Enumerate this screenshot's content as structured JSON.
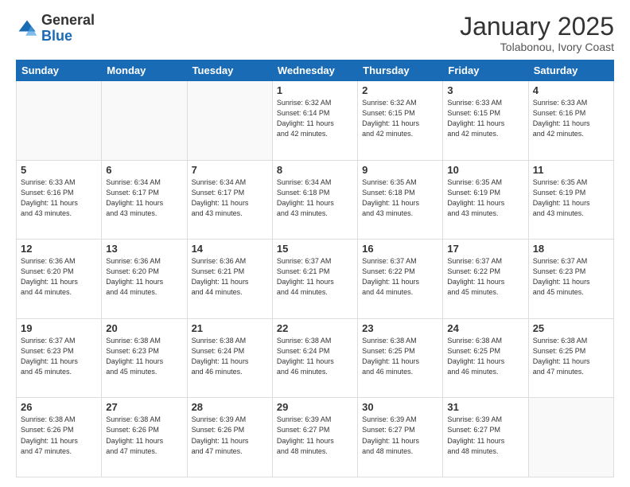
{
  "header": {
    "logo_general": "General",
    "logo_blue": "Blue",
    "month_title": "January 2025",
    "location": "Tolabonou, Ivory Coast"
  },
  "days_of_week": [
    "Sunday",
    "Monday",
    "Tuesday",
    "Wednesday",
    "Thursday",
    "Friday",
    "Saturday"
  ],
  "weeks": [
    [
      {
        "day": "",
        "info": ""
      },
      {
        "day": "",
        "info": ""
      },
      {
        "day": "",
        "info": ""
      },
      {
        "day": "1",
        "info": "Sunrise: 6:32 AM\nSunset: 6:14 PM\nDaylight: 11 hours\nand 42 minutes."
      },
      {
        "day": "2",
        "info": "Sunrise: 6:32 AM\nSunset: 6:15 PM\nDaylight: 11 hours\nand 42 minutes."
      },
      {
        "day": "3",
        "info": "Sunrise: 6:33 AM\nSunset: 6:15 PM\nDaylight: 11 hours\nand 42 minutes."
      },
      {
        "day": "4",
        "info": "Sunrise: 6:33 AM\nSunset: 6:16 PM\nDaylight: 11 hours\nand 42 minutes."
      }
    ],
    [
      {
        "day": "5",
        "info": "Sunrise: 6:33 AM\nSunset: 6:16 PM\nDaylight: 11 hours\nand 43 minutes."
      },
      {
        "day": "6",
        "info": "Sunrise: 6:34 AM\nSunset: 6:17 PM\nDaylight: 11 hours\nand 43 minutes."
      },
      {
        "day": "7",
        "info": "Sunrise: 6:34 AM\nSunset: 6:17 PM\nDaylight: 11 hours\nand 43 minutes."
      },
      {
        "day": "8",
        "info": "Sunrise: 6:34 AM\nSunset: 6:18 PM\nDaylight: 11 hours\nand 43 minutes."
      },
      {
        "day": "9",
        "info": "Sunrise: 6:35 AM\nSunset: 6:18 PM\nDaylight: 11 hours\nand 43 minutes."
      },
      {
        "day": "10",
        "info": "Sunrise: 6:35 AM\nSunset: 6:19 PM\nDaylight: 11 hours\nand 43 minutes."
      },
      {
        "day": "11",
        "info": "Sunrise: 6:35 AM\nSunset: 6:19 PM\nDaylight: 11 hours\nand 43 minutes."
      }
    ],
    [
      {
        "day": "12",
        "info": "Sunrise: 6:36 AM\nSunset: 6:20 PM\nDaylight: 11 hours\nand 44 minutes."
      },
      {
        "day": "13",
        "info": "Sunrise: 6:36 AM\nSunset: 6:20 PM\nDaylight: 11 hours\nand 44 minutes."
      },
      {
        "day": "14",
        "info": "Sunrise: 6:36 AM\nSunset: 6:21 PM\nDaylight: 11 hours\nand 44 minutes."
      },
      {
        "day": "15",
        "info": "Sunrise: 6:37 AM\nSunset: 6:21 PM\nDaylight: 11 hours\nand 44 minutes."
      },
      {
        "day": "16",
        "info": "Sunrise: 6:37 AM\nSunset: 6:22 PM\nDaylight: 11 hours\nand 44 minutes."
      },
      {
        "day": "17",
        "info": "Sunrise: 6:37 AM\nSunset: 6:22 PM\nDaylight: 11 hours\nand 45 minutes."
      },
      {
        "day": "18",
        "info": "Sunrise: 6:37 AM\nSunset: 6:23 PM\nDaylight: 11 hours\nand 45 minutes."
      }
    ],
    [
      {
        "day": "19",
        "info": "Sunrise: 6:37 AM\nSunset: 6:23 PM\nDaylight: 11 hours\nand 45 minutes."
      },
      {
        "day": "20",
        "info": "Sunrise: 6:38 AM\nSunset: 6:23 PM\nDaylight: 11 hours\nand 45 minutes."
      },
      {
        "day": "21",
        "info": "Sunrise: 6:38 AM\nSunset: 6:24 PM\nDaylight: 11 hours\nand 46 minutes."
      },
      {
        "day": "22",
        "info": "Sunrise: 6:38 AM\nSunset: 6:24 PM\nDaylight: 11 hours\nand 46 minutes."
      },
      {
        "day": "23",
        "info": "Sunrise: 6:38 AM\nSunset: 6:25 PM\nDaylight: 11 hours\nand 46 minutes."
      },
      {
        "day": "24",
        "info": "Sunrise: 6:38 AM\nSunset: 6:25 PM\nDaylight: 11 hours\nand 46 minutes."
      },
      {
        "day": "25",
        "info": "Sunrise: 6:38 AM\nSunset: 6:25 PM\nDaylight: 11 hours\nand 47 minutes."
      }
    ],
    [
      {
        "day": "26",
        "info": "Sunrise: 6:38 AM\nSunset: 6:26 PM\nDaylight: 11 hours\nand 47 minutes."
      },
      {
        "day": "27",
        "info": "Sunrise: 6:38 AM\nSunset: 6:26 PM\nDaylight: 11 hours\nand 47 minutes."
      },
      {
        "day": "28",
        "info": "Sunrise: 6:39 AM\nSunset: 6:26 PM\nDaylight: 11 hours\nand 47 minutes."
      },
      {
        "day": "29",
        "info": "Sunrise: 6:39 AM\nSunset: 6:27 PM\nDaylight: 11 hours\nand 48 minutes."
      },
      {
        "day": "30",
        "info": "Sunrise: 6:39 AM\nSunset: 6:27 PM\nDaylight: 11 hours\nand 48 minutes."
      },
      {
        "day": "31",
        "info": "Sunrise: 6:39 AM\nSunset: 6:27 PM\nDaylight: 11 hours\nand 48 minutes."
      },
      {
        "day": "",
        "info": ""
      }
    ]
  ]
}
